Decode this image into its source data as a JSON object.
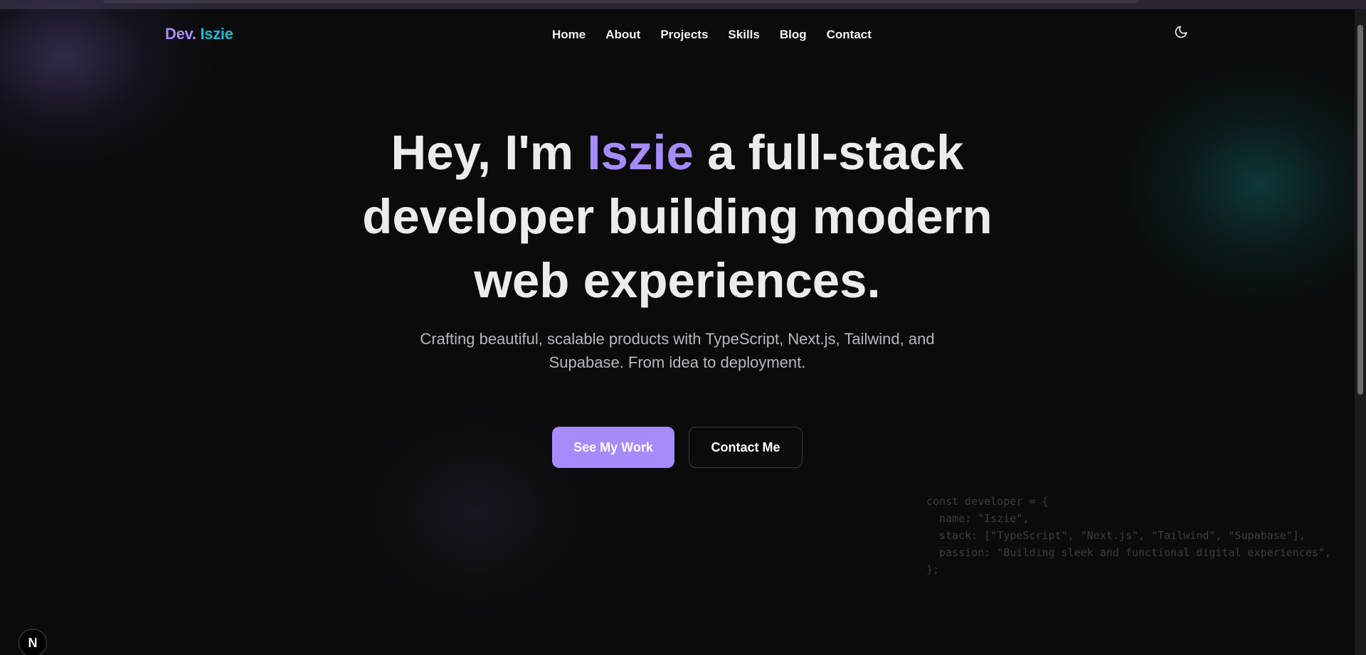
{
  "header": {
    "logo_part1": "Dev.",
    "logo_part2": "Iszie",
    "nav": [
      {
        "label": "Home"
      },
      {
        "label": "About"
      },
      {
        "label": "Projects"
      },
      {
        "label": "Skills"
      },
      {
        "label": "Blog"
      },
      {
        "label": "Contact"
      }
    ],
    "theme_icon": "moon-icon"
  },
  "hero": {
    "title_before": "Hey, I'm",
    "title_accent": "Iszie",
    "title_after": "a full-stack developer building modern web experiences.",
    "subtitle": "Crafting beautiful, scalable products with TypeScript, Next.js, Tailwind, and Supabase. From idea to deployment.",
    "primary_button": "See My Work",
    "secondary_button": "Contact Me"
  },
  "code_snippet": "const developer = {\n  name: \"Iszie\",\n  stack: [\"TypeScript\", \"Next.js\", \"Tailwind\", \"Supabase\"],\n  passion: \"Building sleek and functional digital experiences\",\n};",
  "dev_badge": {
    "letter": "N"
  },
  "colors": {
    "background": "#0b0b0c",
    "accent_purple": "#a78bfa",
    "accent_cyan": "#22b8d8",
    "text": "#ececee",
    "muted_text": "#b7b7bd"
  }
}
